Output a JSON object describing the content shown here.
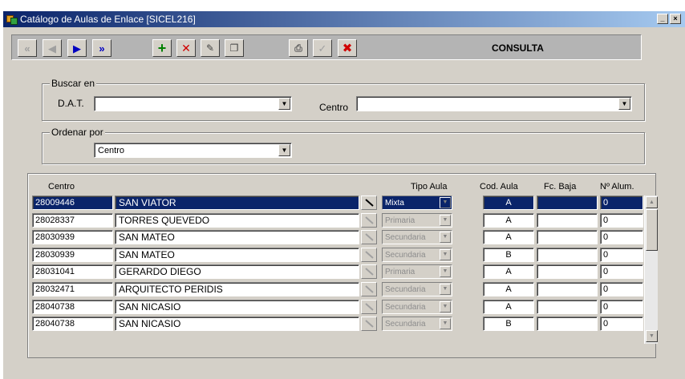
{
  "window": {
    "title": "Catálogo de Aulas de Enlace [SICEL216]"
  },
  "toolbar": {
    "mode": "CONSULTA",
    "icons": [
      "first-record-icon",
      "previous-record-icon",
      "next-record-icon",
      "last-record-icon",
      "add-record-icon",
      "delete-record-icon",
      "clear-icon",
      "copy-icon",
      "print-icon",
      "accept-icon",
      "cancel-icon"
    ]
  },
  "buscar": {
    "legend": "Buscar en",
    "dat_label": "D.A.T.",
    "dat_value": "",
    "centro_label": "Centro",
    "centro_value": ""
  },
  "ordenar": {
    "legend": "Ordenar por",
    "value": "Centro"
  },
  "table": {
    "headers": {
      "centro": "Centro",
      "tipo_aula": "Tipo Aula",
      "cod_aula": "Cod. Aula",
      "fc_baja": "Fc. Baja",
      "num_alum": "Nº Alum."
    },
    "rows": [
      {
        "code": "28009446",
        "name": "SAN VIATOR",
        "tipo": "Mixta",
        "cod": "A",
        "baja": "",
        "alum": "0",
        "selected": true
      },
      {
        "code": "28028337",
        "name": "TORRES QUEVEDO",
        "tipo": "Primaria",
        "cod": "A",
        "baja": "",
        "alum": "0"
      },
      {
        "code": "28030939",
        "name": "SAN MATEO",
        "tipo": "Secundaria",
        "cod": "A",
        "baja": "",
        "alum": "0"
      },
      {
        "code": "28030939",
        "name": "SAN MATEO",
        "tipo": "Secundaria",
        "cod": "B",
        "baja": "",
        "alum": "0"
      },
      {
        "code": "28031041",
        "name": "GERARDO DIEGO",
        "tipo": "Primaria",
        "cod": "A",
        "baja": "",
        "alum": "0"
      },
      {
        "code": "28032471",
        "name": "ARQUITECTO PERIDIS",
        "tipo": "Secundaria",
        "cod": "A",
        "baja": "",
        "alum": "0"
      },
      {
        "code": "28040738",
        "name": "SAN NICASIO",
        "tipo": "Secundaria",
        "cod": "A",
        "baja": "",
        "alum": "0"
      },
      {
        "code": "28040738",
        "name": "SAN NICASIO",
        "tipo": "Secundaria",
        "cod": "B",
        "baja": "",
        "alum": "0"
      }
    ]
  }
}
